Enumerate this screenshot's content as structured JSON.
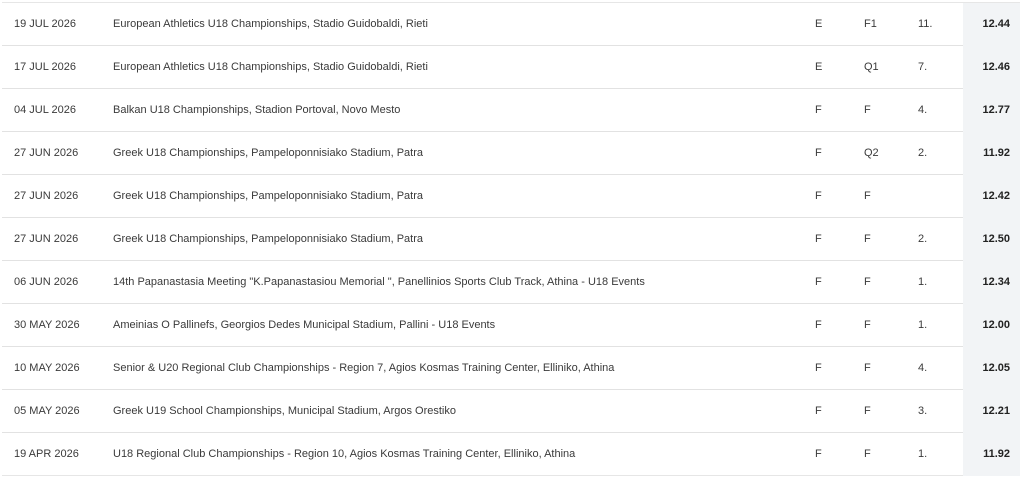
{
  "results": [
    {
      "date": "19 JUL 2026",
      "competition": "European Athletics U18 Championships, Stadio Guidobaldi, Rieti",
      "category": "E",
      "race": "F1",
      "place": "11.",
      "mark": "12.44"
    },
    {
      "date": "17 JUL 2026",
      "competition": "European Athletics U18 Championships, Stadio Guidobaldi, Rieti",
      "category": "E",
      "race": "Q1",
      "place": "7.",
      "mark": "12.46"
    },
    {
      "date": "04 JUL 2026",
      "competition": "Balkan U18 Championships, Stadion Portoval, Novo Mesto",
      "category": "F",
      "race": "F",
      "place": "4.",
      "mark": "12.77"
    },
    {
      "date": "27 JUN 2026",
      "competition": "Greek U18 Championships, Pampeloponnisiako Stadium, Patra",
      "category": "F",
      "race": "Q2",
      "place": "2.",
      "mark": "11.92"
    },
    {
      "date": "27 JUN 2026",
      "competition": "Greek U18 Championships, Pampeloponnisiako Stadium, Patra",
      "category": "F",
      "race": "F",
      "place": "",
      "mark": "12.42"
    },
    {
      "date": "27 JUN 2026",
      "competition": "Greek U18 Championships, Pampeloponnisiako Stadium, Patra",
      "category": "F",
      "race": "F",
      "place": "2.",
      "mark": "12.50"
    },
    {
      "date": "06 JUN 2026",
      "competition": "14th Papanastasia Meeting \"K.Papanastasiou Memorial \", Panellinios Sports Club Track, Athina - U18 Events",
      "category": "F",
      "race": "F",
      "place": "1.",
      "mark": "12.34"
    },
    {
      "date": "30 MAY 2026",
      "competition": "Ameinias O Pallinefs, Georgios Dedes Municipal Stadium, Pallini - U18 Events",
      "category": "F",
      "race": "F",
      "place": "1.",
      "mark": "12.00"
    },
    {
      "date": "10 MAY 2026",
      "competition": "Senior & U20 Regional Club Championships - Region 7, Agios Kosmas Training Center, Elliniko, Athina",
      "category": "F",
      "race": "F",
      "place": "4.",
      "mark": "12.05"
    },
    {
      "date": "05 MAY 2026",
      "competition": "Greek U19 School Championships, Municipal Stadium, Argos Orestiko",
      "category": "F",
      "race": "F",
      "place": "3.",
      "mark": "12.21"
    },
    {
      "date": "19 APR 2026",
      "competition": "U18 Regional Club Championships - Region 10, Agios Kosmas Training Center, Elliniko, Athina",
      "category": "F",
      "race": "F",
      "place": "1.",
      "mark": "11.92"
    }
  ]
}
